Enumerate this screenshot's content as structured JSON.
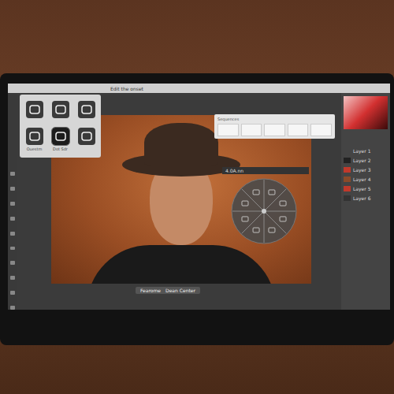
{
  "screen": {
    "menu_title": "Edit the onset"
  },
  "tool_palette": {
    "tools": [
      {
        "label": "",
        "selected": false
      },
      {
        "label": "",
        "selected": false
      },
      {
        "label": "",
        "selected": false
      },
      {
        "label": "Ouestm",
        "selected": false
      },
      {
        "label": "Dot Sdr",
        "selected": true
      },
      {
        "label": "",
        "selected": false
      }
    ]
  },
  "top_panel": {
    "title": "Sequences",
    "cells": 5
  },
  "radial_menu": {
    "label": "4.0A.nn",
    "segments": 8
  },
  "bottom_bar": {
    "items": [
      "Fearome",
      "Dean Center"
    ]
  },
  "right_panel": {
    "layers": [
      {
        "name": "Layer 1",
        "color": "#444444"
      },
      {
        "name": "Layer 2",
        "color": "#222222"
      },
      {
        "name": "Layer 3",
        "color": "#c0392b"
      },
      {
        "name": "Layer 4",
        "color": "#8a4a2a"
      },
      {
        "name": "Layer 5",
        "color": "#c0392b"
      },
      {
        "name": "Layer 6",
        "color": "#333333"
      }
    ]
  }
}
